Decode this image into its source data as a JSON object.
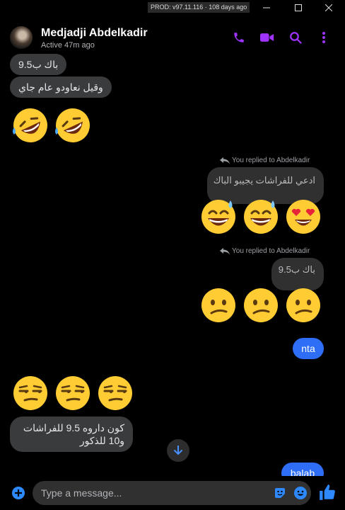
{
  "window": {
    "prod_badge": "PROD: v97.11.116 · 108 days ago"
  },
  "header": {
    "contact_name": "Medjadji Abdelkadir",
    "status": "Active 47m ago",
    "accent_color": "#a033ff",
    "icons": [
      "phone-icon",
      "video-camera-icon",
      "search-icon",
      "more-options-icon"
    ]
  },
  "messages": {
    "m1": "باك ب9.5",
    "m2": "وقيل نعاودو عام جاي",
    "reply1_note": "You replied to Abdelkadir",
    "reply1_quote": "ادعي للفراشات يجيبو الباك",
    "reply2_note": "You replied to Abdelkadir",
    "reply2_quote": "باك ب9.5",
    "nta": "nta",
    "m_last_line1": "كون داروه 9.5 للفراشات",
    "m_last_line2": "و10 للذكور",
    "balab": "balab"
  },
  "emojis": {
    "row1": [
      "rofl",
      "rofl"
    ],
    "row2": [
      "sweat-smile",
      "sweat-smile",
      "heart-eyes"
    ],
    "row3": [
      "confused",
      "confused",
      "confused"
    ],
    "row4": [
      "unamused",
      "unamused",
      "unamused"
    ]
  },
  "composer": {
    "placeholder": "Type a message...",
    "icons": [
      "add-icon",
      "sticker-icon",
      "emoji-icon",
      "thumbs-up-icon"
    ]
  },
  "colors": {
    "bubble_out": "#2e6df6",
    "bubble_in": "#3a3b3c",
    "icon_blue": "#2e89ff"
  }
}
